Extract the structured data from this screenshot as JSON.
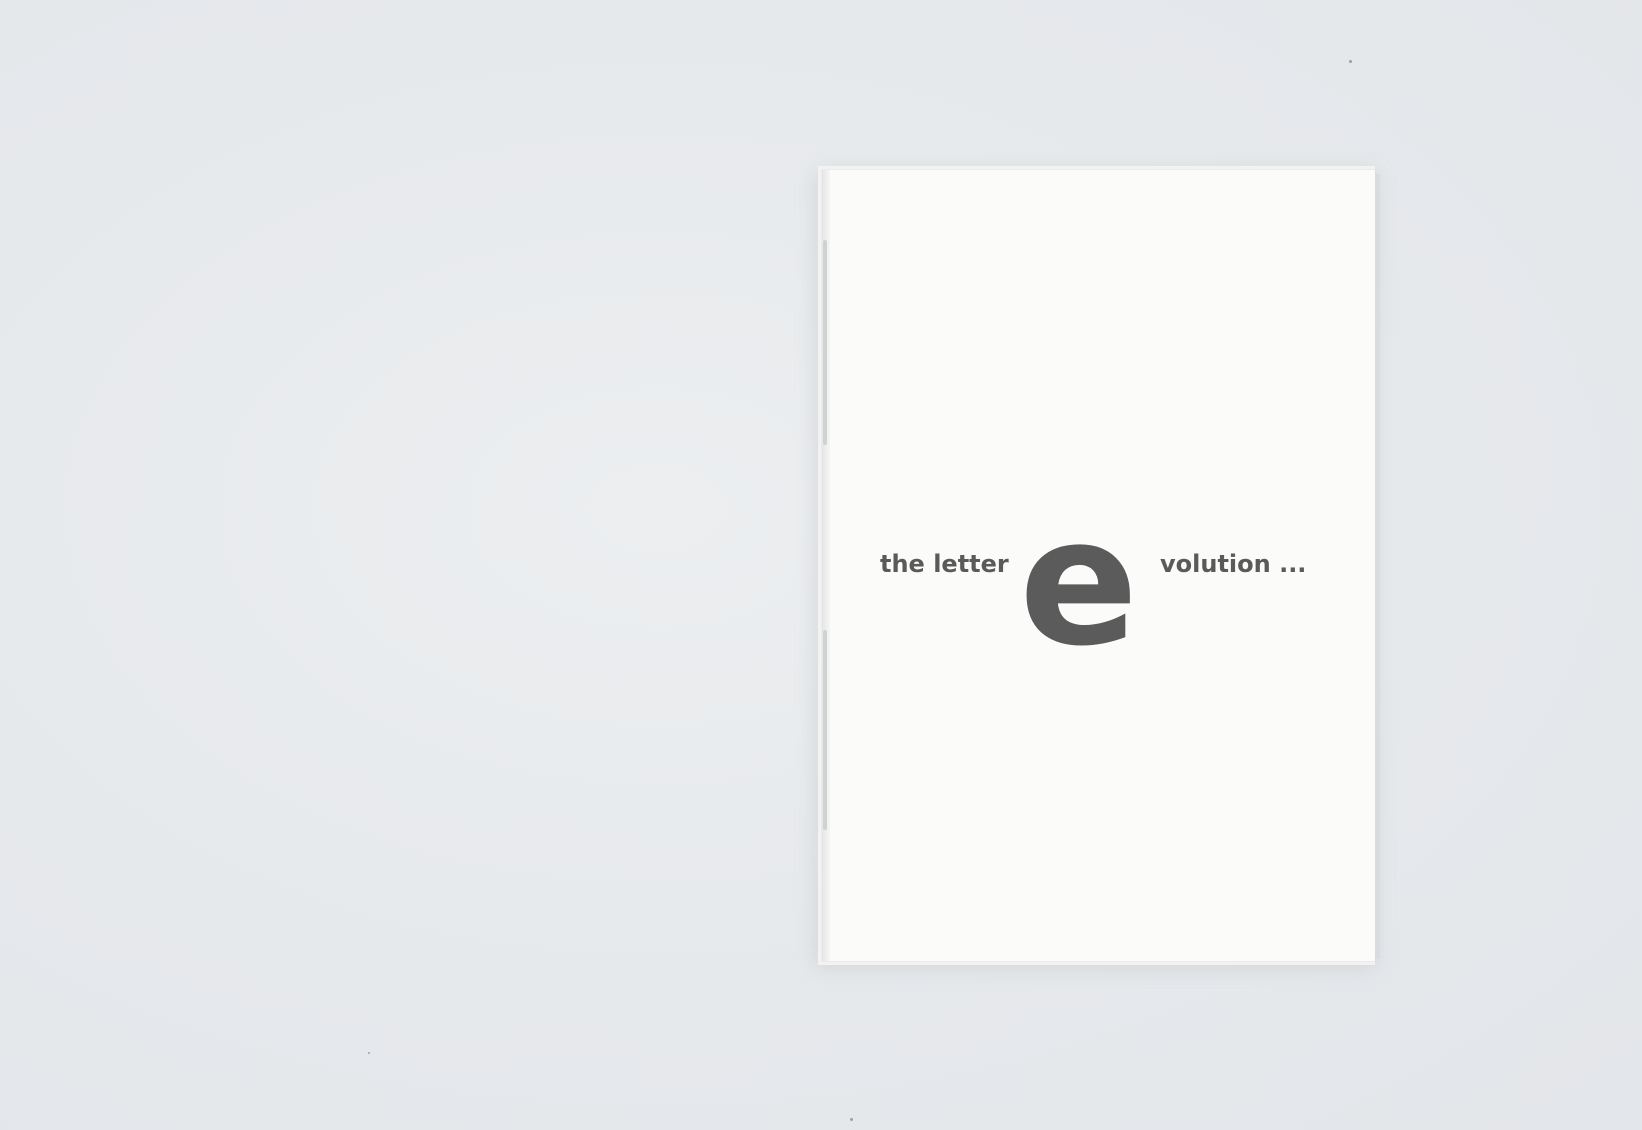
{
  "scene": {
    "background_color": "#e6e9ec",
    "booklet_color": "#fbfbf9",
    "ink_color": "#5a5a5a"
  },
  "cover": {
    "title_prefix": "the letter",
    "title_big_letter": "e",
    "title_suffix": "volution ..."
  }
}
